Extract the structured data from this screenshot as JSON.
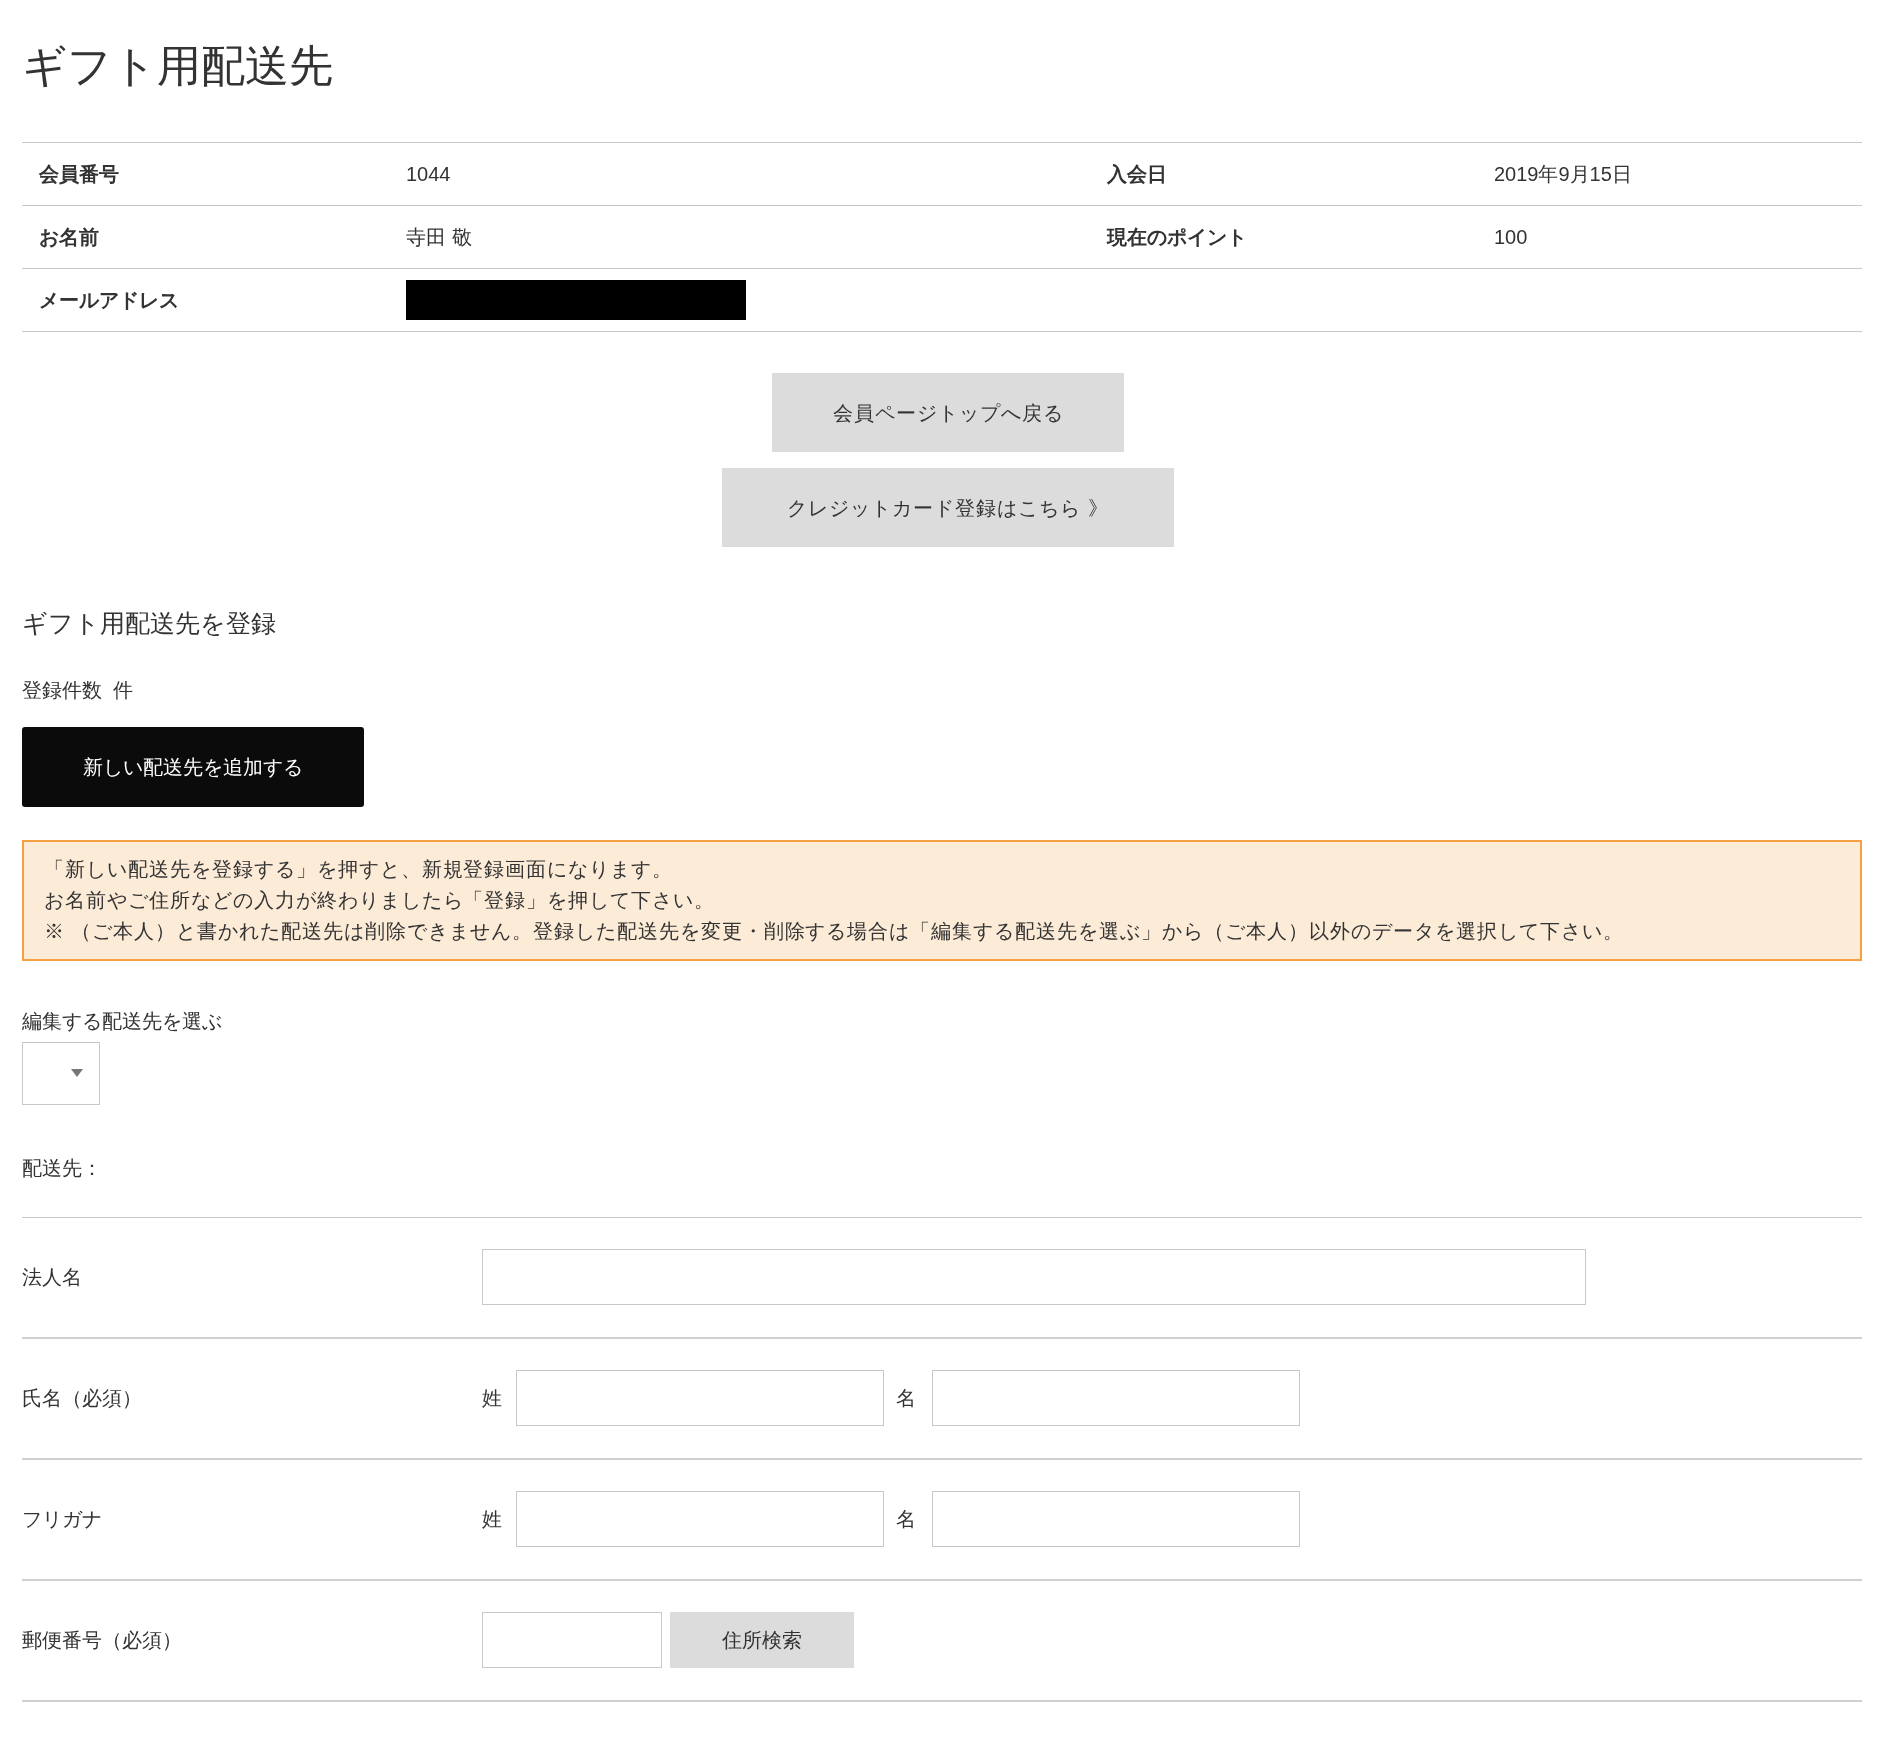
{
  "title": "ギフト用配送先",
  "member_table": [
    {
      "label": "会員番号",
      "value": "1044",
      "label2": "入会日",
      "value2": "2019年9月15日"
    },
    {
      "label": "お名前",
      "value": "寺田 敬",
      "label2": "現在のポイント",
      "value2": "100"
    },
    {
      "label": "メールアドレス",
      "redacted": true
    }
  ],
  "buttons": [
    "会員ページトップへ戻る",
    "クレジットカード登録はこちら 》"
  ],
  "section_title": "ギフト用配送先を登録",
  "count_text": "登録件数  件",
  "add_button": "新しい配送先を追加する",
  "notice": [
    "「新しい配送先を登録する」を押すと、新規登録画面になります。",
    "お名前やご住所などの入力が終わりましたら「登録」を押して下さい。",
    "※ （ご本人）と書かれた配送先は削除できません。登録した配送先を変更・削除する場合は「編集する配送先を選ぶ」から（ご本人）以外のデータを選択して下さい。"
  ],
  "select_label": "編集する配送先を選ぶ",
  "destination_label": "配送先：",
  "form_rows": [
    {
      "kind": "single",
      "label": "法人名"
    },
    {
      "kind": "pair",
      "label": "氏名（必須）",
      "sub1": "姓",
      "sub2": "名"
    },
    {
      "kind": "pair",
      "label": "フリガナ",
      "sub1": "姓",
      "sub2": "名"
    },
    {
      "kind": "postal",
      "label": "郵便番号（必須）",
      "button": "住所検索"
    }
  ]
}
